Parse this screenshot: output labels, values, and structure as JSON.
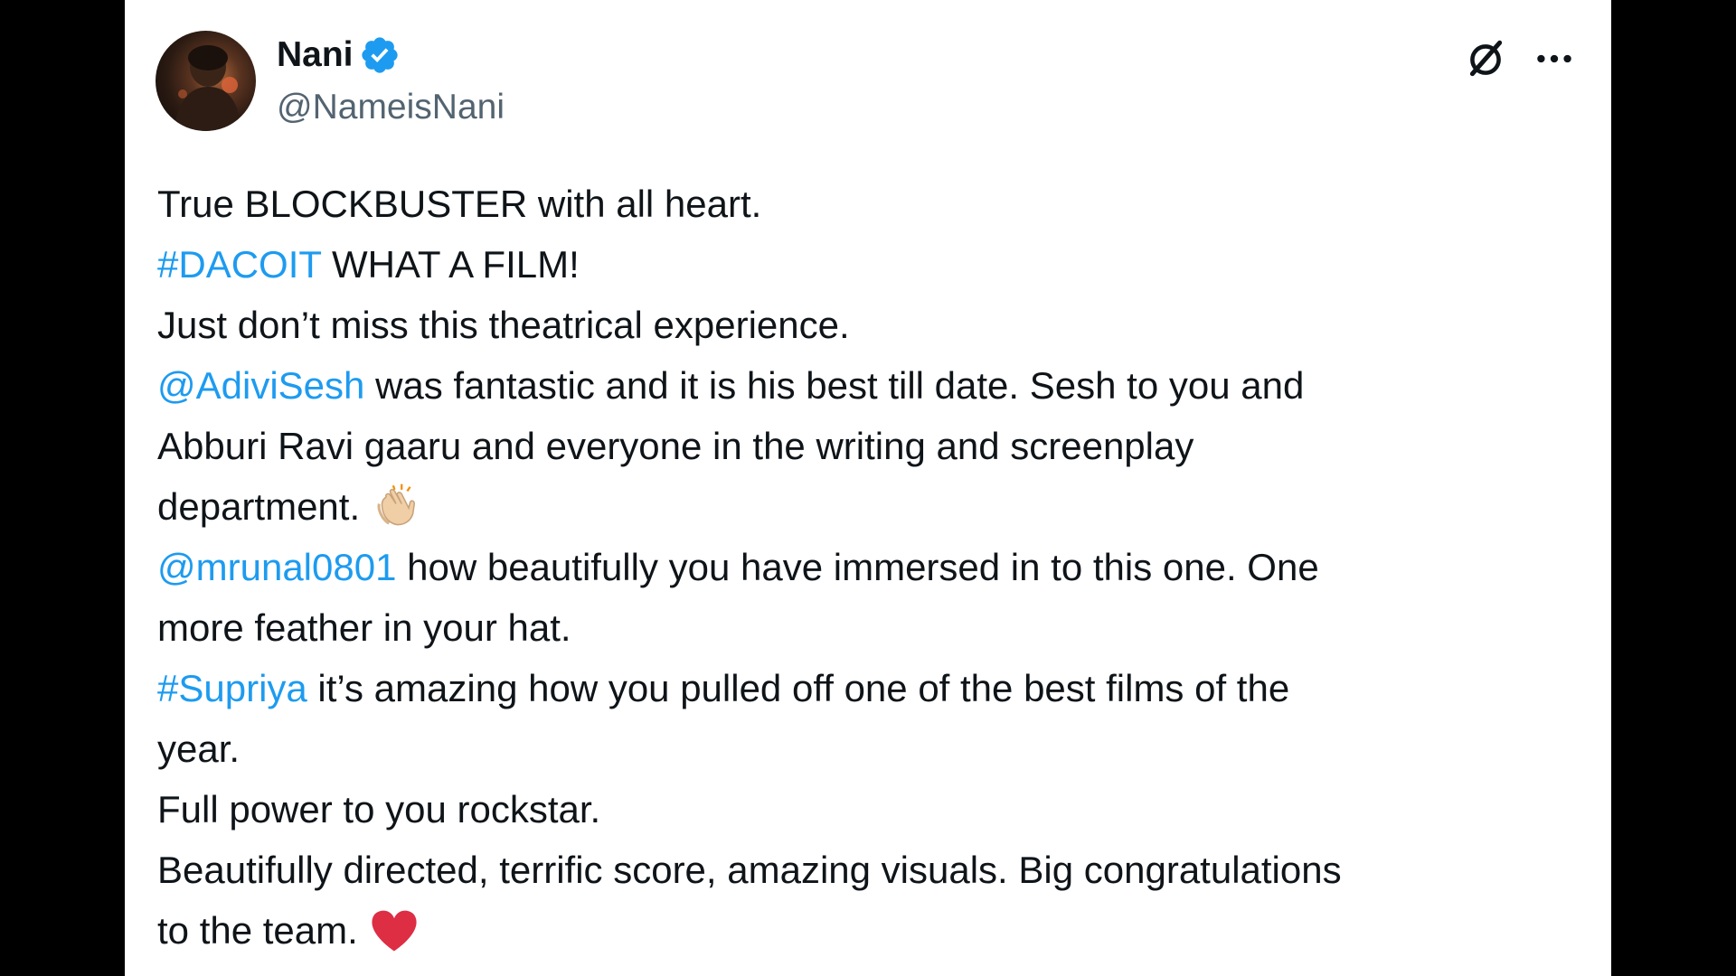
{
  "author": {
    "name": "Nani",
    "handle": "@NameisNani",
    "verified": true,
    "verified_color": "#1d9bf0"
  },
  "header_actions": {
    "grok_icon": "grok-icon",
    "more_icon": "more-icon"
  },
  "tweet": {
    "l1": "True BLOCKBUSTER with all heart.",
    "l2_tag": "#DACOIT",
    "l2_rest": " WHAT A FILM!",
    "l3": "Just don’t miss this theatrical experience.",
    "l4_mention": "@AdiviSesh",
    "l4_rest": " was fantastic and it is his best till date. Sesh to you and",
    "l5": "Abburi Ravi gaaru and everyone in the writing and screenplay",
    "l6": "department.",
    "l7_mention": "@mrunal0801",
    "l7_rest": " how beautifully you have immersed in to this one. One",
    "l8": "more feather in your hat.",
    "l9_tag": "#Supriya",
    "l9_rest": " it’s amazing how you pulled off one of the best films of the",
    "l10": "year.",
    "l11": "Full power to you rockstar.",
    "l12": "Beautifully directed, terrific score, amazing visuals. Big congratulations",
    "l13": "to the team."
  },
  "colors": {
    "link": "#1d9bf0",
    "text": "#0f1419",
    "secondary": "#536471",
    "heart": "#dd2e44"
  }
}
